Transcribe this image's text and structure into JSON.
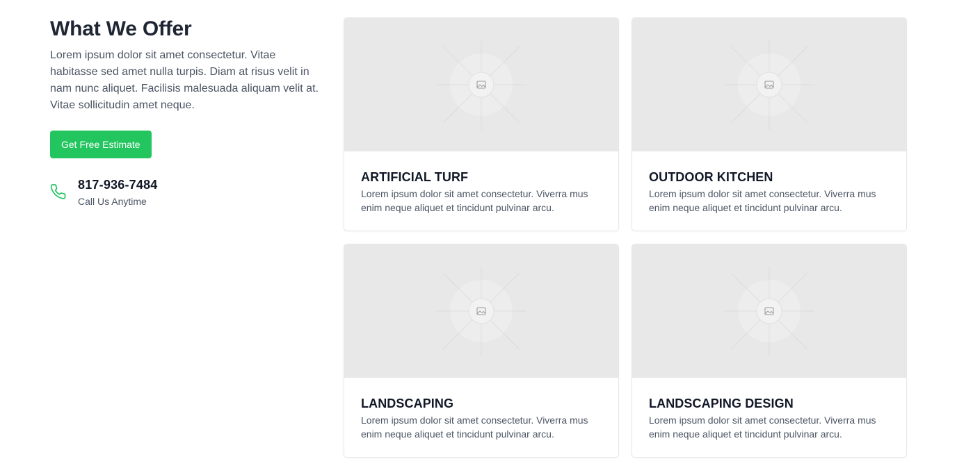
{
  "section": {
    "title": "What We Offer",
    "intro": "Lorem ipsum dolor sit amet consectetur. Vitae habitasse sed amet nulla turpis. Diam at risus velit in nam nunc aliquet. Facilisis malesuada aliquam velit at. Vitae sollicitudin amet neque.",
    "cta_label": "Get Free Estimate"
  },
  "contact": {
    "icon": "phone-icon",
    "phone": "817-936-7484",
    "caption": "Call Us Anytime"
  },
  "services": [
    {
      "title": "ARTIFICIAL TURF",
      "description": "Lorem ipsum dolor sit amet consectetur. Viverra mus enim neque aliquet et tincidunt pulvinar arcu.",
      "image_icon": "image-placeholder-icon"
    },
    {
      "title": "OUTDOOR KITCHEN",
      "description": "Lorem ipsum dolor sit amet consectetur. Viverra mus enim neque aliquet et tincidunt pulvinar arcu.",
      "image_icon": "image-placeholder-icon"
    },
    {
      "title": "LANDSCAPING",
      "description": "Lorem ipsum dolor sit amet consectetur. Viverra mus enim neque aliquet et tincidunt pulvinar arcu.",
      "image_icon": "image-placeholder-icon"
    },
    {
      "title": "LANDSCAPING DESIGN",
      "description": "Lorem ipsum dolor sit amet consectetur. Viverra mus enim neque aliquet et tincidunt pulvinar arcu.",
      "image_icon": "image-placeholder-icon"
    }
  ],
  "colors": {
    "accent": "#22c55e",
    "heading": "#1e2533",
    "body_text": "#4b5563",
    "placeholder_bg": "#e8e8e8"
  }
}
